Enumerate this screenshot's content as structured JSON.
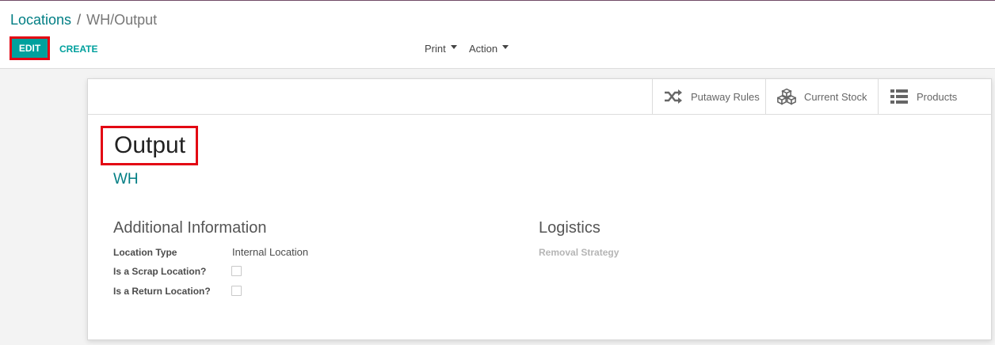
{
  "breadcrumb": {
    "parent": "Locations",
    "separator": "/",
    "current": "WH/Output"
  },
  "toolbar": {
    "edit_label": "EDIT",
    "create_label": "CREATE",
    "print_label": "Print",
    "action_label": "Action"
  },
  "button_box": {
    "putaway": {
      "label": "Putaway Rules",
      "icon": "shuffle-icon"
    },
    "stock": {
      "label": "Current Stock",
      "icon": "cubes-icon"
    },
    "products": {
      "label": "Products",
      "icon": "list-icon"
    }
  },
  "record": {
    "name": "Output",
    "parent_location": "WH"
  },
  "groups": {
    "additional": {
      "title": "Additional Information",
      "location_type_label": "Location Type",
      "location_type_value": "Internal Location",
      "scrap_label": "Is a Scrap Location?",
      "scrap_checked": false,
      "return_label": "Is a Return Location?",
      "return_checked": false
    },
    "logistics": {
      "title": "Logistics",
      "removal_label": "Removal Strategy"
    }
  },
  "colors": {
    "primary": "#00a09d",
    "link": "#017e84",
    "highlight": "#e30613"
  }
}
